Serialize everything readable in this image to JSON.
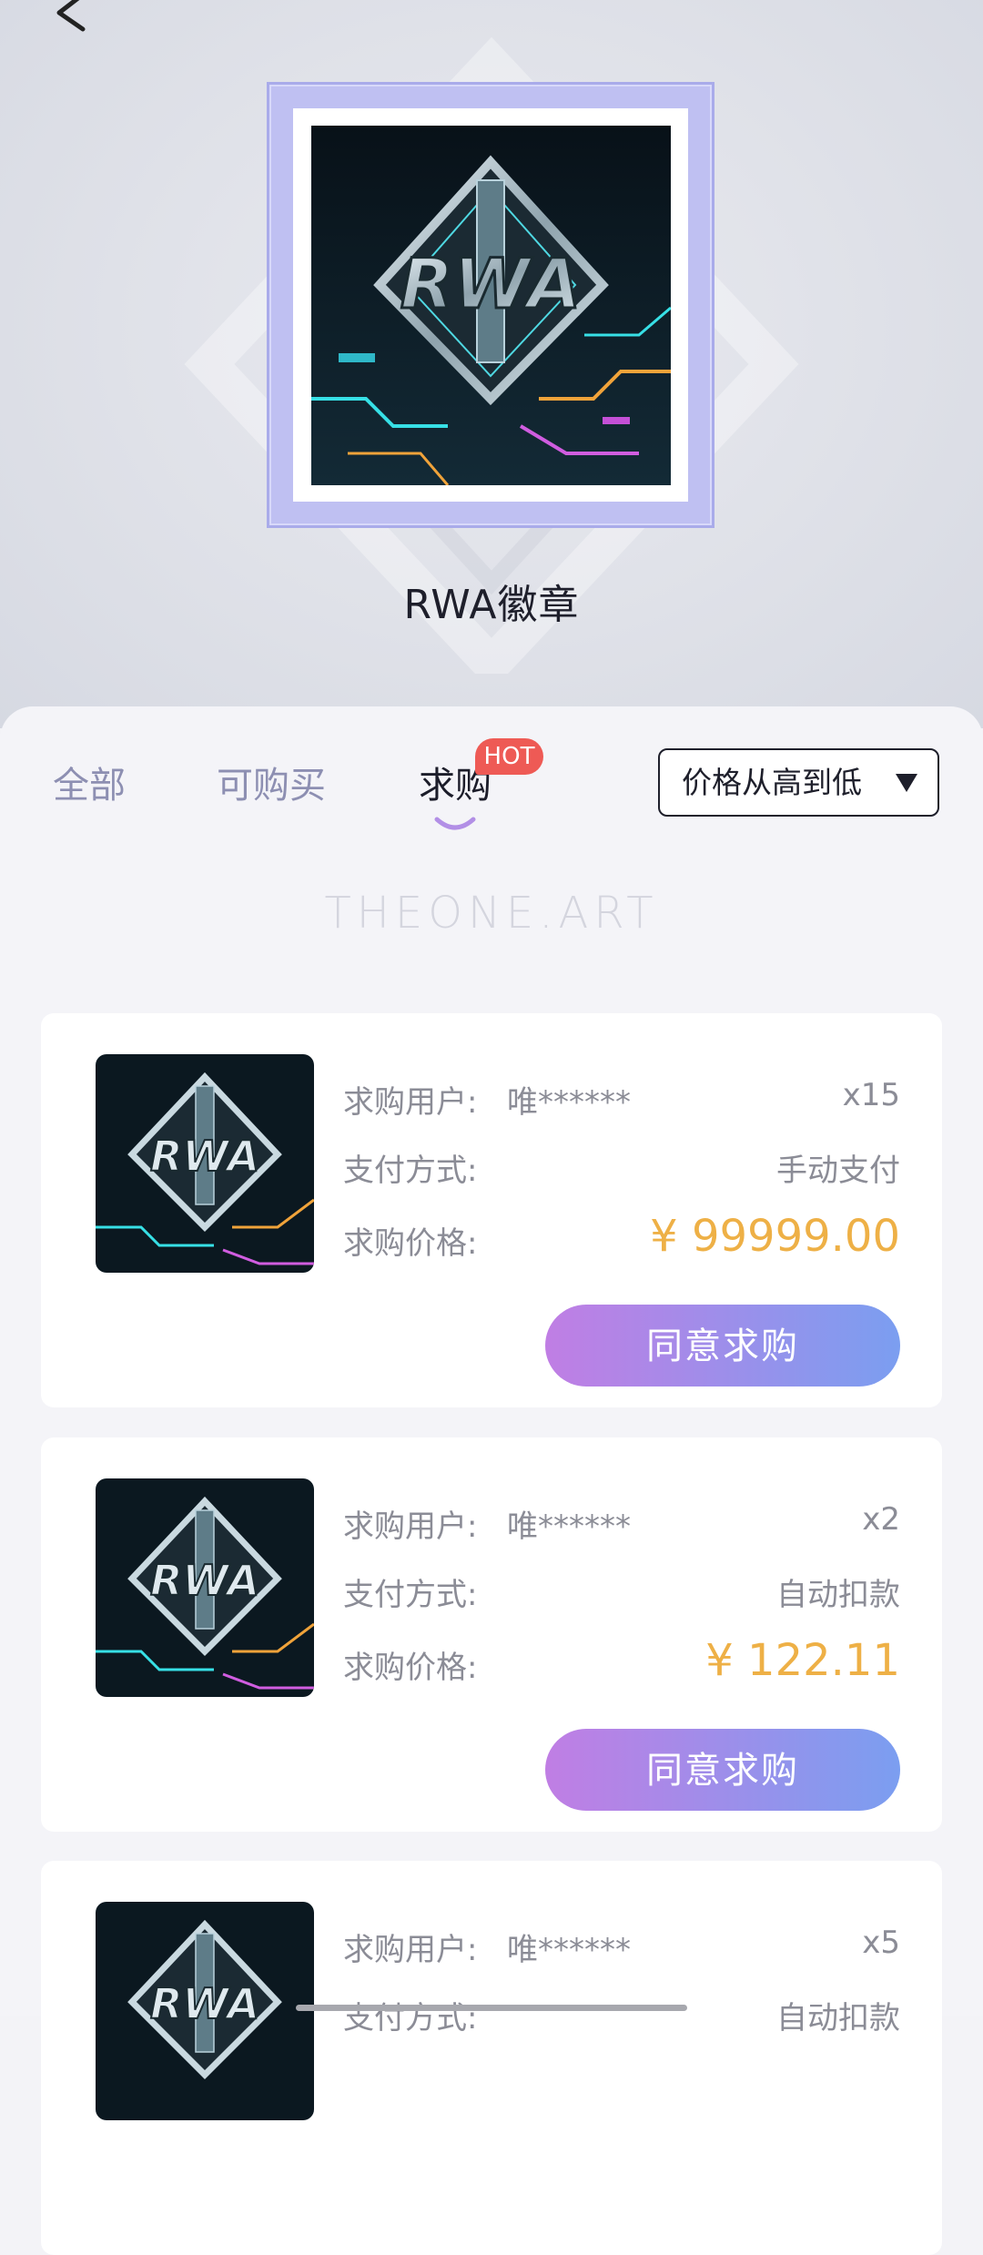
{
  "header": {
    "title": "RWA徽章",
    "back_icon": "chevron-left-icon"
  },
  "artwork": {
    "name": "RWA"
  },
  "tabs": [
    {
      "label": "全部",
      "active": false
    },
    {
      "label": "可购买",
      "active": false
    },
    {
      "label": "求购",
      "active": true,
      "badge": "HOT"
    }
  ],
  "sort": {
    "label": "价格从高到低",
    "icon": "caret-down-icon"
  },
  "watermark": "THEONE.ART",
  "cards": [
    {
      "buyer_label": "求购用户:",
      "buyer": "唯******",
      "quantity": "x15",
      "payment_label": "支付方式:",
      "payment": "手动支付",
      "price_label": "求购价格:",
      "price": "¥ 99999.00",
      "action": "同意求购"
    },
    {
      "buyer_label": "求购用户:",
      "buyer": "唯******",
      "quantity": "x2",
      "payment_label": "支付方式:",
      "payment": "自动扣款",
      "price_label": "求购价格:",
      "price": "¥ 122.11",
      "action": "同意求购"
    },
    {
      "buyer_label": "求购用户:",
      "buyer": "唯******",
      "quantity": "x5",
      "payment_label": "支付方式:",
      "payment": "自动扣款"
    }
  ],
  "colors": {
    "price": "#eeb046",
    "button_start": "#c07ee4",
    "button_end": "#7b9ef0",
    "hot_badge": "#ee5a55",
    "tab_inactive": "#8d8fb2"
  }
}
